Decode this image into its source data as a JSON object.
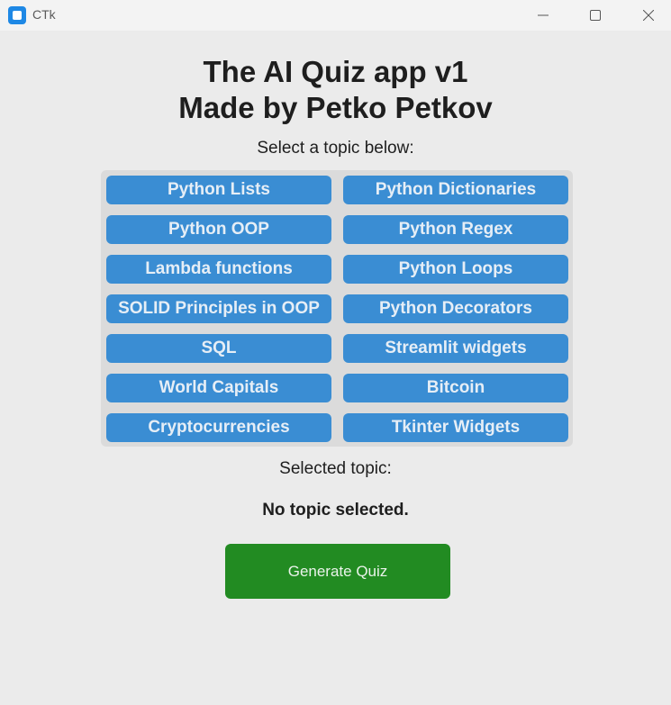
{
  "window": {
    "title": "CTk",
    "icon": "app-icon"
  },
  "header": {
    "title_line1": "The AI Quiz app v1",
    "title_line2": "Made by Petko Petkov",
    "subtitle": "Select a topic below:"
  },
  "topics": [
    "Python Lists",
    "Python Dictionaries",
    "Python OOP",
    "Python Regex",
    "Lambda functions",
    "Python Loops",
    "SOLID Principles in OOP",
    "Python Decorators",
    "SQL",
    "Streamlit widgets",
    "World Capitals",
    "Bitcoin",
    "Cryptocurrencies",
    "Tkinter Widgets"
  ],
  "selection": {
    "caption": "Selected topic:",
    "value": "No topic selected."
  },
  "actions": {
    "generate_label": "Generate Quiz"
  },
  "colors": {
    "topic_button": "#3a8dd3",
    "generate_button": "#228b22",
    "background": "#ebebeb"
  }
}
